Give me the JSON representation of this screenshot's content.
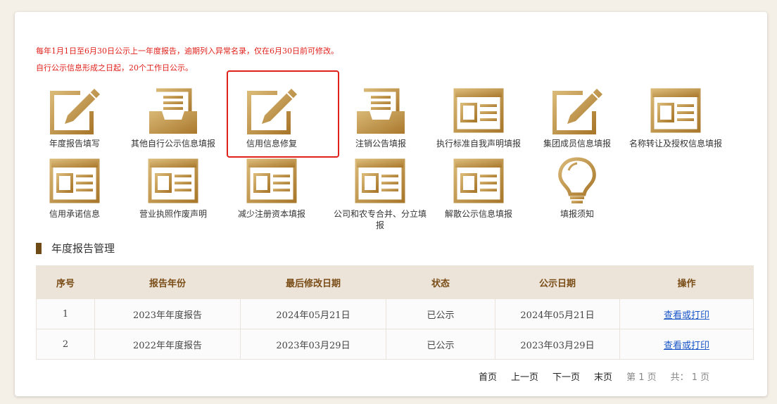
{
  "notices": [
    "每年1月1日至6月30日公示上一年度报告，逾期列入异常名录，仅在6月30日前可修改。",
    "自行公示信息形成之日起，20个工作日公示。"
  ],
  "tiles": [
    {
      "label": "年度报告填写",
      "icon": "edit-icon"
    },
    {
      "label": "其他自行公示信息填报",
      "icon": "inbox-icon"
    },
    {
      "label": "信用信息修复",
      "icon": "edit-icon"
    },
    {
      "label": "注销公告填报",
      "icon": "inbox-icon"
    },
    {
      "label": "执行标准自我声明填报",
      "icon": "form-icon"
    },
    {
      "label": "集团成员信息填报",
      "icon": "edit-icon"
    },
    {
      "label": "名称转让及授权信息填报",
      "icon": "form-icon"
    },
    {
      "label": "信用承诺信息",
      "icon": "form-icon"
    },
    {
      "label": "营业执照作废声明",
      "icon": "form-icon"
    },
    {
      "label": "减少注册资本填报",
      "icon": "form-icon"
    },
    {
      "label": "公司和农专合并、分立填报",
      "icon": "form-icon"
    },
    {
      "label": "解散公示信息填报",
      "icon": "form-icon"
    },
    {
      "label": "填报须知",
      "icon": "lightbulb-icon"
    }
  ],
  "section": {
    "title": "年度报告管理"
  },
  "table": {
    "headers": [
      "序号",
      "报告年份",
      "最后修改日期",
      "状态",
      "公示日期",
      "操作"
    ],
    "rows": [
      [
        "1",
        "2023年年度报告",
        "2024年05月21日",
        "已公示",
        "2024年05月21日",
        "查看或打印"
      ],
      [
        "2",
        "2022年年度报告",
        "2023年03月29日",
        "已公示",
        "2023年03月29日",
        "查看或打印"
      ]
    ]
  },
  "pager": {
    "first": "首页",
    "prev": "上一页",
    "next": "下一页",
    "last": "末页",
    "current": "第 1 页",
    "total": "共： 1 页"
  },
  "colors": {
    "accent": "#c8a04e",
    "notice": "#e0201b",
    "link": "#1a56c8",
    "header_bg": "#ece4d9"
  }
}
